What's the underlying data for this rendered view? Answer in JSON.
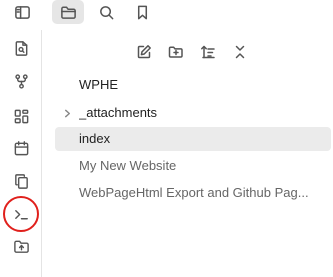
{
  "topbar": {
    "items": [
      {
        "icon": "sidebar-toggle-icon",
        "active": false
      },
      {
        "icon": "folder-icon",
        "active": true
      },
      {
        "icon": "search-icon",
        "active": false
      },
      {
        "icon": "bookmark-icon",
        "active": false
      }
    ]
  },
  "ribbon": {
    "items": [
      {
        "icon": "file-search-icon"
      },
      {
        "icon": "git-fork-icon"
      },
      {
        "icon": "layout-dashboard-icon"
      },
      {
        "icon": "calendar-icon"
      },
      {
        "icon": "copy-icon"
      },
      {
        "icon": "terminal-icon",
        "highlighted": true
      },
      {
        "icon": "folder-upload-icon"
      }
    ]
  },
  "file_explorer": {
    "actions": [
      {
        "icon": "new-note-icon"
      },
      {
        "icon": "new-folder-icon"
      },
      {
        "icon": "sort-icon"
      },
      {
        "icon": "collapse-all-icon"
      }
    ],
    "vault_name": "WPHE",
    "items": [
      {
        "label": "_attachments",
        "type": "folder",
        "collapsed": true,
        "selected": false
      },
      {
        "label": "index",
        "type": "file",
        "selected": true
      },
      {
        "label": "My New Website",
        "type": "file",
        "selected": false
      },
      {
        "label": "WebPageHtml Export and Github Pag...",
        "type": "file",
        "selected": false
      }
    ]
  },
  "colors": {
    "highlight_ring": "#e0201c",
    "selected_row": "#ebebeb",
    "active_tab": "#e6e6e6"
  }
}
